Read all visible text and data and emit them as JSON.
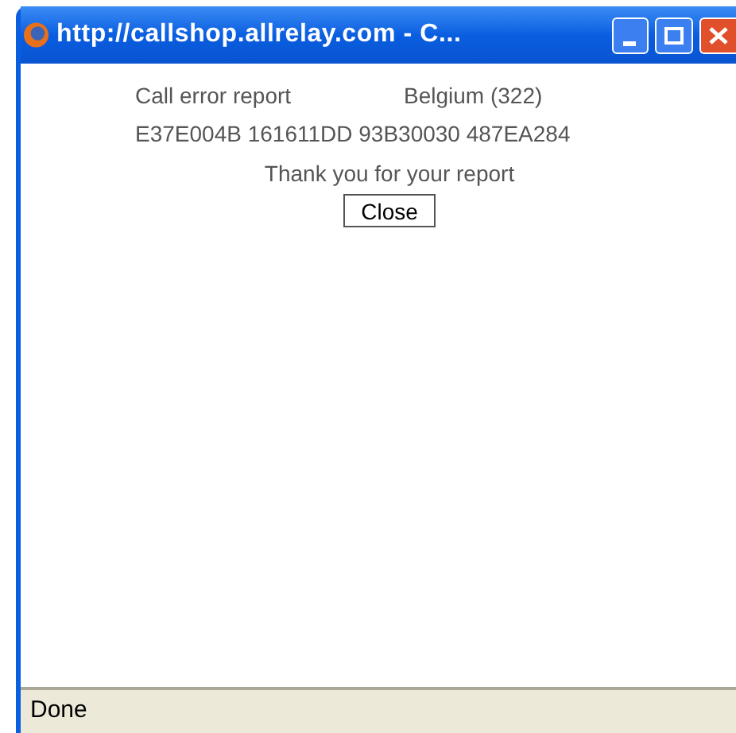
{
  "window": {
    "title": "http://callshop.allrelay.com - C..."
  },
  "report": {
    "label": "Call error report",
    "country": "Belgium (322)",
    "code": "E37E004B 161611DD 93B30030 487EA284",
    "message": "Thank you for your report",
    "button": "Close"
  },
  "status_bar": {
    "text": "Done"
  }
}
